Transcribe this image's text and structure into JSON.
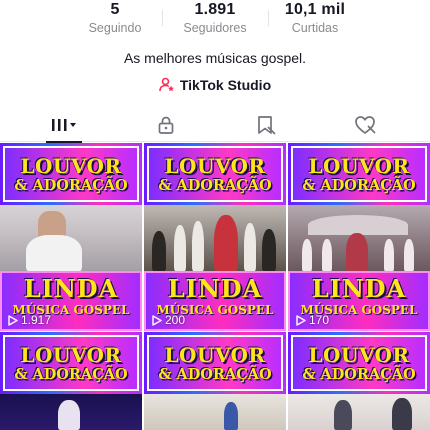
{
  "profile": {
    "stats": [
      {
        "value": "5",
        "label": "Seguindo"
      },
      {
        "value": "1.891",
        "label": "Seguidores"
      },
      {
        "value": "10,1 mil",
        "label": "Curtidas"
      }
    ],
    "bio": "As melhores músicas gospel.",
    "studio_label": "TikTok Studio"
  },
  "tabs": [
    {
      "name": "videos-grid",
      "icon": "grid-icon",
      "active": true
    },
    {
      "name": "private",
      "icon": "lock-icon",
      "active": false
    },
    {
      "name": "favorites",
      "icon": "bookmark-icon",
      "active": false
    },
    {
      "name": "liked",
      "icon": "heart-icon",
      "active": false
    }
  ],
  "grid": {
    "top_banner": {
      "line1": "LOUVOR",
      "line2": "& ADORAÇÃO"
    },
    "videos": [
      {
        "title_line1": "LINDA",
        "title_line2": "MÚSICA GOSPEL",
        "plays": "1.917"
      },
      {
        "title_line1": "LINDA",
        "title_line2": "MÚSICA GOSPEL",
        "plays": "200"
      },
      {
        "title_line1": "LINDA",
        "title_line2": "MÚSICA GOSPEL",
        "plays": "170"
      }
    ]
  },
  "colors": {
    "accent": "#ff2dbe",
    "title_yellow": "#ffe51a",
    "muted": "#8a8b91",
    "text": "#161823"
  }
}
